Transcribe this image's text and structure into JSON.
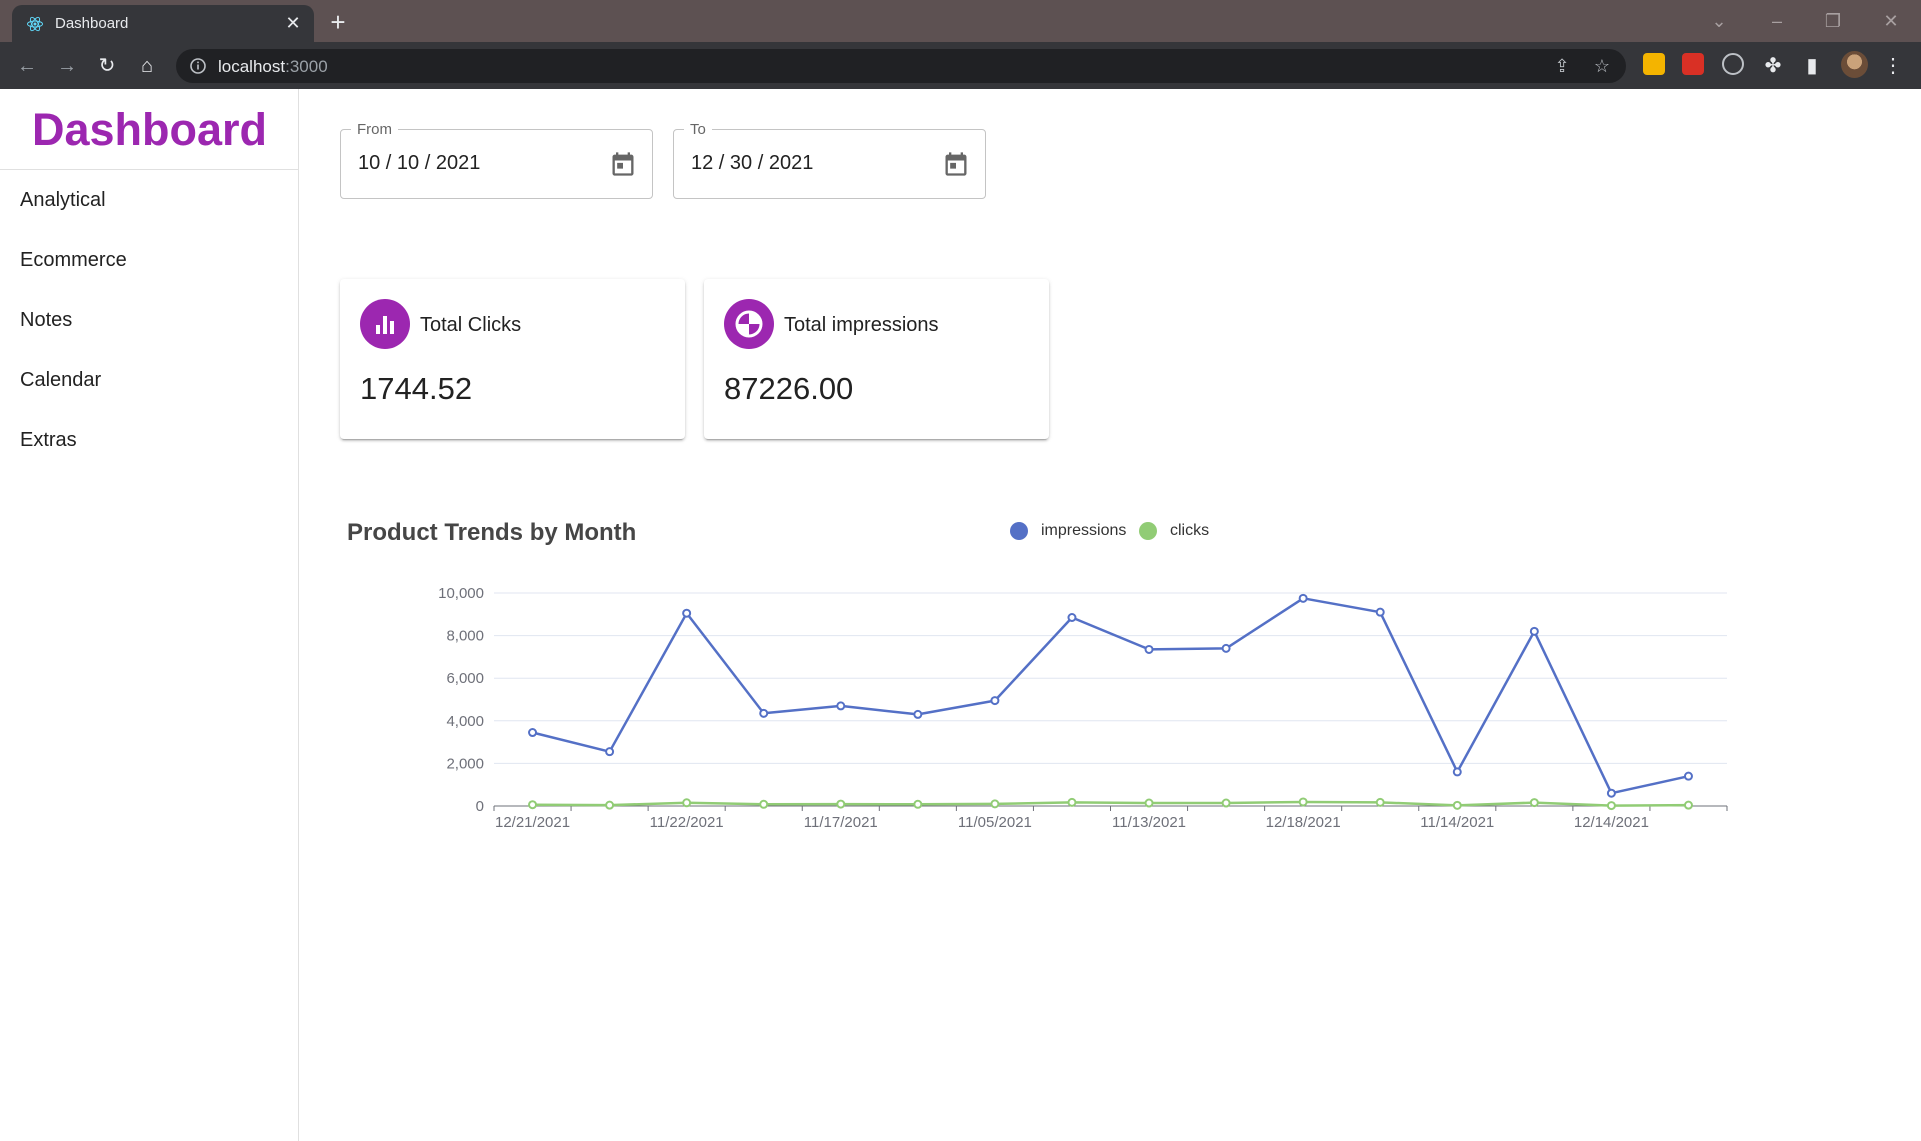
{
  "browser": {
    "tab_title": "Dashboard",
    "url_host": "localhost",
    "url_port": ":3000"
  },
  "sidebar": {
    "logo": "Dashboard",
    "items": [
      {
        "label": "Analytical"
      },
      {
        "label": "Ecommerce"
      },
      {
        "label": "Notes"
      },
      {
        "label": "Calendar"
      },
      {
        "label": "Extras"
      }
    ]
  },
  "filters": {
    "from_label": "From",
    "from_value": "10 / 10 / 2021",
    "to_label": "To",
    "to_value": "12 / 30 / 2021"
  },
  "cards": [
    {
      "title": "Total Clicks",
      "value": "1744.52",
      "icon": "bar-chart-icon"
    },
    {
      "title": "Total impressions",
      "value": "87226.00",
      "icon": "pie-chart-icon"
    }
  ],
  "colors": {
    "brand": "#9c27b0",
    "impressions": "#5470c6",
    "clicks": "#91cc75"
  },
  "chart_data": {
    "type": "line",
    "title": "Product Trends by Month",
    "xlabel": "",
    "ylabel": "",
    "legend_position": "top-center",
    "grid": true,
    "ylim": [
      0,
      10000
    ],
    "y_ticks": [
      "0",
      "2,000",
      "4,000",
      "6,000",
      "8,000",
      "10,000"
    ],
    "x_tick_labels": [
      "12/21/2021",
      "11/22/2021",
      "11/17/2021",
      "11/05/2021",
      "11/13/2021",
      "12/18/2021",
      "11/14/2021",
      "12/14/2021"
    ],
    "series": [
      {
        "name": "impressions",
        "values": [
          3450,
          2550,
          9050,
          4350,
          4700,
          4300,
          4950,
          8850,
          7350,
          7400,
          9750,
          9100,
          1600,
          8200,
          600,
          1400
        ]
      },
      {
        "name": "clicks",
        "values": [
          60,
          40,
          150,
          80,
          90,
          80,
          100,
          170,
          140,
          140,
          190,
          170,
          30,
          160,
          20,
          40
        ]
      }
    ]
  }
}
